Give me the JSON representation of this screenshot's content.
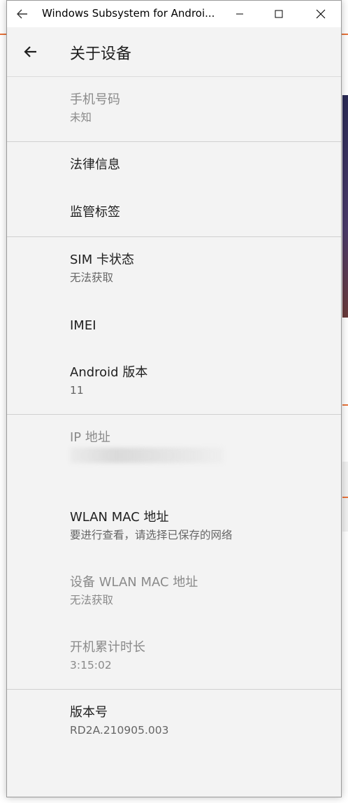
{
  "window": {
    "title": "Windows Subsystem for Androi..."
  },
  "appbar": {
    "title": "关于设备"
  },
  "items": [
    {
      "title": "手机号码",
      "subtitle": "未知",
      "disabled": true
    },
    {
      "title": "法律信息",
      "subtitle": ""
    },
    {
      "title": "监管标签",
      "subtitle": ""
    },
    {
      "title": "SIM 卡状态",
      "subtitle": "无法获取"
    },
    {
      "title": "IMEI",
      "subtitle": ""
    },
    {
      "title": "Android 版本",
      "subtitle": "11"
    },
    {
      "title": "IP 地址",
      "subtitle": "",
      "disabled": true
    },
    {
      "title": "WLAN MAC 地址",
      "subtitle": "要进行查看，请选择已保存的网络"
    },
    {
      "title": "设备 WLAN MAC 地址",
      "subtitle": "无法获取",
      "disabled": true
    },
    {
      "title": "开机累计时长",
      "subtitle": "3:15:02",
      "disabled": true
    },
    {
      "title": "版本号",
      "subtitle": "RD2A.210905.003"
    }
  ],
  "colors": {
    "accent": "#e8733a",
    "background": "#f3f3f3",
    "text_primary": "#1f1f1f",
    "text_secondary": "#666666",
    "divider": "#d0d0d0"
  },
  "icons": {
    "titlebar_back": "back-arrow-icon",
    "minimize": "minimize-icon",
    "maximize": "maximize-icon",
    "close": "close-icon",
    "nav_back": "back-arrow-icon"
  }
}
